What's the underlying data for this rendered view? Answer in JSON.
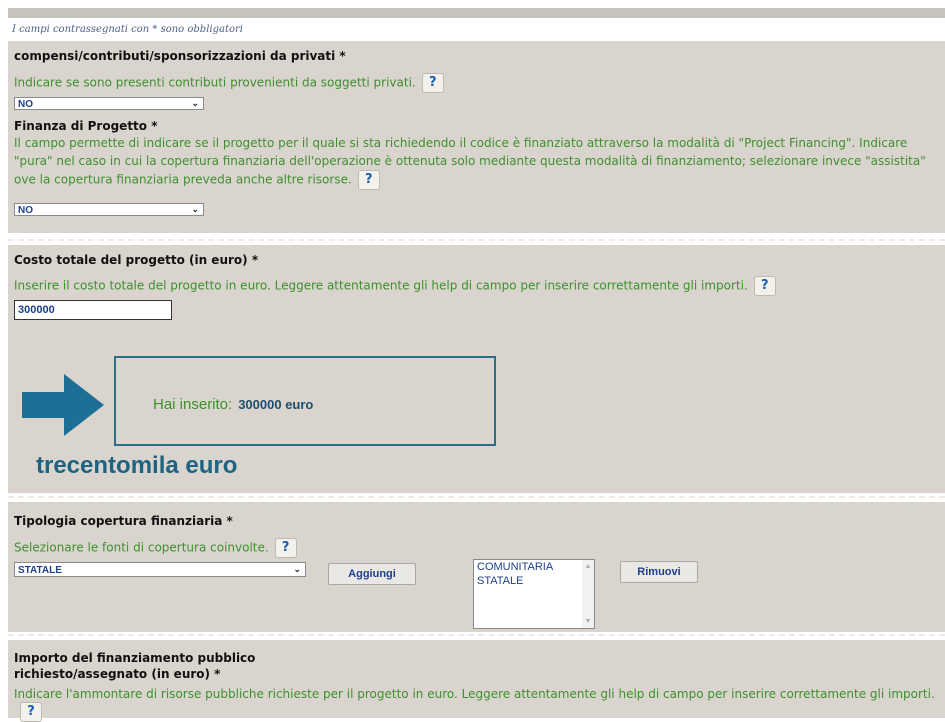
{
  "note": "I campi contrassegnati con * sono obbligatori",
  "help_icon": "?",
  "privati": {
    "label": "compensi/contributi/sponsorizzazioni da privati *",
    "help": "Indicare se sono presenti contributi provenienti da soggetti privati.",
    "value": "NO"
  },
  "finanza": {
    "label": "Finanza di Progetto *",
    "help": "Il campo permette di indicare se il progetto per il quale si sta richiedendo il codice è finanziato attraverso la modalità di \"Project Financing\". Indicare \"pura\" nel caso in cui la copertura finanziaria dell'operazione è ottenuta solo mediante questa modalità di finanziamento; selezionare invece \"assistita\" ove la copertura finanziaria preveda anche altre risorse.",
    "value": "NO"
  },
  "costo": {
    "label": "Costo totale del progetto (in euro) *",
    "help": "Inserire il costo totale del progetto in euro. Leggere attentamente gli help di campo per inserire correttamente gli importi.",
    "value": "300000",
    "result_prefix": "Hai inserito:",
    "result_value": "300000 euro",
    "words": "trecentomila euro"
  },
  "tipologia": {
    "label": "Tipologia copertura finanziaria *",
    "help": "Selezionare le fonti di copertura coinvolte.",
    "value": "STATALE",
    "add_label": "Aggiungi",
    "remove_label": "Rimuovi",
    "selected": [
      "COMUNITARIA",
      "STATALE"
    ]
  },
  "importo": {
    "label_line1": "Importo del finanziamento pubblico",
    "label_line2": "richiesto/assegnato (in euro) *",
    "help": "Indicare l'ammontare di risorse pubbliche richieste per il progetto in euro. Leggere attentamente gli help di campo per inserire correttamente gli importi."
  },
  "colors": {
    "help_text": "#3f8f2f",
    "panel_bg": "#d9d5ce",
    "value_text": "#1d3f8c",
    "accent": "#1e6381"
  }
}
